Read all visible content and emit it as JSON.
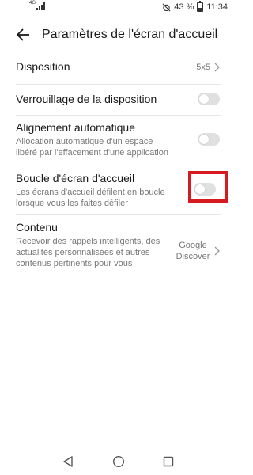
{
  "status_bar": {
    "signal_label": "4G",
    "battery": "43 %",
    "battery_level": 0.43,
    "time": "11:34"
  },
  "header": {
    "title": "Paramètres de l'écran d'accueil"
  },
  "settings": [
    {
      "title": "Disposition",
      "value": "5x5"
    },
    {
      "title": "Verrouillage de la disposition",
      "toggle": false
    },
    {
      "title": "Alignement automatique",
      "description": "Allocation automatique d'un espace libéré par l'effacement d'une application",
      "toggle": false
    },
    {
      "title": "Boucle d'écran d'accueil",
      "description": "Les écrans d'accueil défilent en boucle lorsque vous les faites défiler",
      "toggle": false,
      "highlighted": true
    },
    {
      "title": "Contenu",
      "description": "Recevoir des rappels intelligents, des actualités personnalisées et autres contenus pertinents pour vous",
      "value": "Google Discover"
    }
  ],
  "colors": {
    "highlight": "#d71920",
    "toggle_off": "#e0e0e0"
  },
  "icons": {
    "back": "back-arrow-icon",
    "chevron": "chevron-right-icon",
    "nav_back": "triangle-back-icon",
    "nav_home": "circle-home-icon",
    "nav_recent": "square-recents-icon"
  }
}
